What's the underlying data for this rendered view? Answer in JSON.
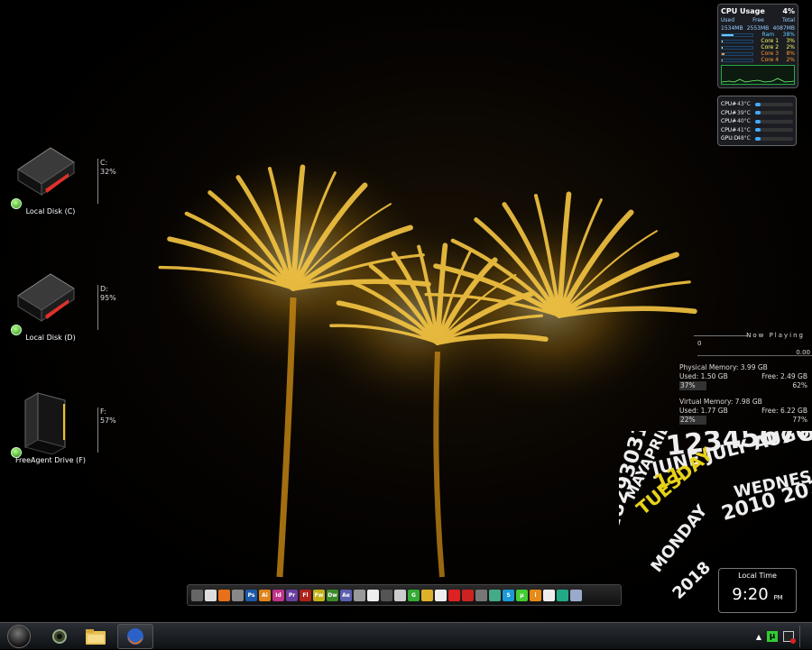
{
  "drives": [
    {
      "label": "Local Disk (C)",
      "meter_letter": "C:",
      "meter_pct": "32%",
      "type": "hdd"
    },
    {
      "label": "Local Disk (D)",
      "meter_letter": "D:",
      "meter_pct": "95%",
      "type": "hdd"
    },
    {
      "label": "FreeAgent Drive (F)",
      "meter_letter": "F:",
      "meter_pct": "57%",
      "type": "external"
    }
  ],
  "cpu_usage": {
    "title": "CPU Usage",
    "percent": "4%",
    "cols": [
      "Used",
      "Free",
      "Total"
    ],
    "vals": [
      "1534MB",
      "2553MB",
      "4087MB"
    ],
    "rows": [
      {
        "name": "Ram",
        "pct": "38%",
        "color": "#6cf"
      },
      {
        "name": "Core 1",
        "pct": "3%",
        "color": "#ff6"
      },
      {
        "name": "Core 2",
        "pct": "2%",
        "color": "#ff6"
      },
      {
        "name": "Core 3",
        "pct": "8%",
        "color": "#f93"
      },
      {
        "name": "Core 4",
        "pct": "2%",
        "color": "#f93"
      }
    ]
  },
  "temps": [
    {
      "name": "CPU#",
      "value": "43°C"
    },
    {
      "name": "CPU#",
      "value": "39°C"
    },
    {
      "name": "CPU#",
      "value": "40°C"
    },
    {
      "name": "CPU#",
      "value": "41°C"
    },
    {
      "name": "GPU:D",
      "value": "48°C"
    }
  ],
  "now_playing": {
    "title": "Now Playing",
    "left": "0",
    "right": "0.00"
  },
  "physical_memory": {
    "title": "Physical Memory: 3.99 GB",
    "used": "Used: 1.50 GB",
    "free": "Free: 2.49 GB",
    "used_pct": "37%",
    "free_pct": "62%"
  },
  "virtual_memory": {
    "title": "Virtual Memory: 7.98 GB",
    "used": "Used: 1.77 GB",
    "free": "Free: 6.22 GB",
    "used_pct": "22%",
    "free_pct": "77%"
  },
  "swirl": {
    "numbers": "123456789",
    "months": "JUNE JULY AUGUST SE",
    "month_prev": "MAYAPRILMARCH",
    "weekday": "TUESDAY",
    "weekday_next": "WEDNES",
    "weekday_prev": "MONDAY",
    "day": "11",
    "years": "2010 2011 20",
    "years_prev": "2018",
    "days_prev": "28293031",
    "accent": "#e8d21a"
  },
  "clock": {
    "caption": "Local Time",
    "time": "9:20",
    "ampm": "PM"
  },
  "dock_icons": [
    {
      "name": "monitor",
      "color": "#666",
      "text": ""
    },
    {
      "name": "wifi",
      "color": "#ddd",
      "text": ""
    },
    {
      "name": "firefox",
      "color": "#e8701a",
      "text": ""
    },
    {
      "name": "tool",
      "color": "#888",
      "text": ""
    },
    {
      "name": "ps",
      "color": "#1d5aa8",
      "text": "Ps"
    },
    {
      "name": "ai",
      "color": "#e0831a",
      "text": "Ai"
    },
    {
      "name": "id",
      "color": "#c2338a",
      "text": "Id"
    },
    {
      "name": "pr",
      "color": "#6a3fa0",
      "text": "Pr"
    },
    {
      "name": "fl",
      "color": "#b0211a",
      "text": "Fl"
    },
    {
      "name": "fw",
      "color": "#c2b21a",
      "text": "Fw"
    },
    {
      "name": "dw",
      "color": "#3d8a2c",
      "text": "Dw"
    },
    {
      "name": "ae",
      "color": "#5b5fb0",
      "text": "Ae"
    },
    {
      "name": "app1",
      "color": "#999",
      "text": ""
    },
    {
      "name": "app2",
      "color": "#eee",
      "text": ""
    },
    {
      "name": "app3",
      "color": "#555",
      "text": ""
    },
    {
      "name": "app4",
      "color": "#ccc",
      "text": ""
    },
    {
      "name": "chrome",
      "color": "#3a3",
      "text": "G"
    },
    {
      "name": "app5",
      "color": "#ddb02a",
      "text": ""
    },
    {
      "name": "app6",
      "color": "#eee",
      "text": ""
    },
    {
      "name": "app7",
      "color": "#d22",
      "text": ""
    },
    {
      "name": "app8",
      "color": "#c22",
      "text": ""
    },
    {
      "name": "app9",
      "color": "#777",
      "text": ""
    },
    {
      "name": "app10",
      "color": "#4a8",
      "text": ""
    },
    {
      "name": "skype",
      "color": "#1a9ad8",
      "text": "S"
    },
    {
      "name": "utorrent",
      "color": "#4c3",
      "text": "µ"
    },
    {
      "name": "app11",
      "color": "#e88a1a",
      "text": "i"
    },
    {
      "name": "app12",
      "color": "#eee",
      "text": ""
    },
    {
      "name": "app13",
      "color": "#2a8",
      "text": ""
    },
    {
      "name": "recycle",
      "color": "#9ac",
      "text": ""
    }
  ]
}
